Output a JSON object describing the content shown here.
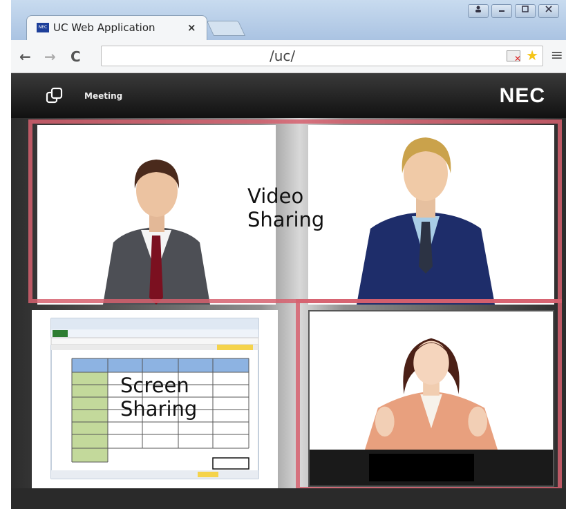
{
  "browser": {
    "tab_title": "UC Web Application",
    "tab_close": "×",
    "favicon_text": "NEC",
    "url": "/uc/",
    "back_icon": "←",
    "forward_icon": "→",
    "reload_icon": "C",
    "menu_icon": "≡",
    "star_icon": "★",
    "window_buttons": [
      "user-icon",
      "minimize-icon",
      "maximize-icon",
      "close-icon"
    ]
  },
  "app": {
    "section_label": "Meeting",
    "brand": "NEC"
  },
  "labels": {
    "video_line1": "Video",
    "video_line2": "Sharing",
    "screen_line1": "Screen",
    "screen_line2": "Sharing"
  },
  "controls": {
    "laptop_icon": "laptop-icon",
    "fullscreen_icon": "fullscreen-icon"
  },
  "colors": {
    "highlight": "#d6606e",
    "header_bg": "#1a1a1a",
    "browser_frame": "#b8cde6"
  }
}
